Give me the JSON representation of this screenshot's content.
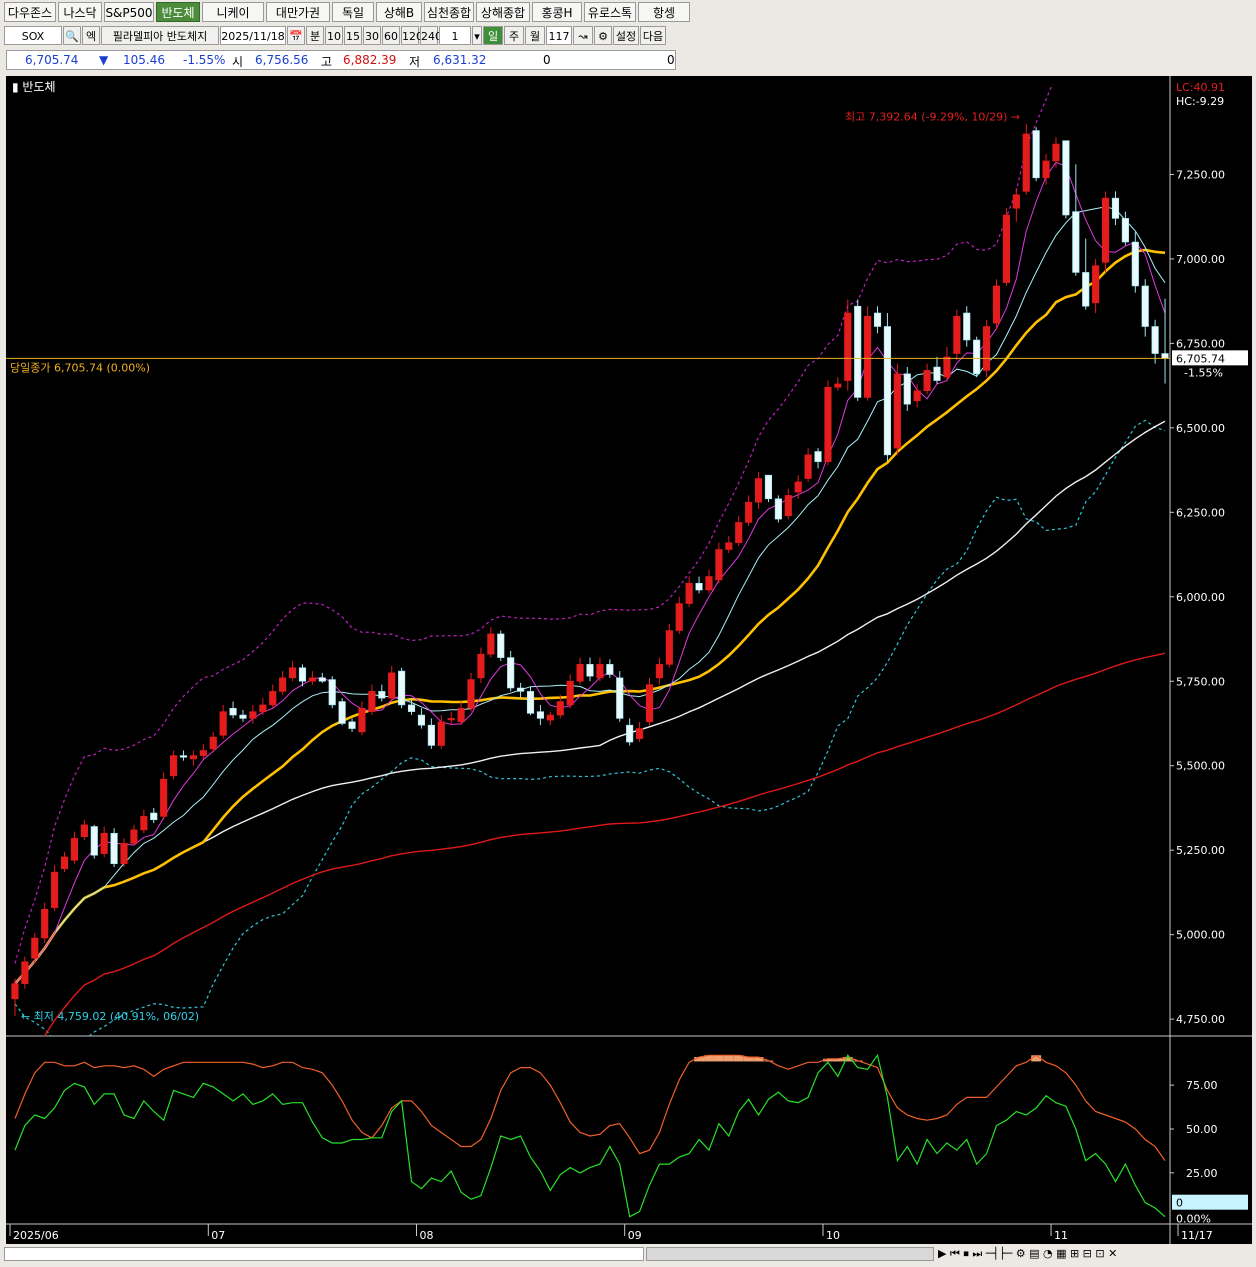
{
  "tabs": [
    "다우존스",
    "나스닥",
    "S&P500",
    "반도체",
    "니케이",
    "대만가권",
    "독일",
    "상해B",
    "심천종합",
    "상해종합",
    "홍콩H",
    "유로스톡",
    "항셍"
  ],
  "active_tab": "반도체",
  "toolbar": {
    "symbol": "SOX",
    "name_label": "필라델피아 반도체지",
    "date": "2025/11/18",
    "period_minute": "분",
    "minute_options": [
      "10",
      "15",
      "30",
      "60",
      "120",
      "240"
    ],
    "count": "1",
    "period_day": "일",
    "period_week": "주",
    "period_month": "월",
    "bars": "117",
    "settings_label": "설정",
    "next_label": "다음"
  },
  "quote": {
    "price": "6,705.74",
    "arrow": "▼",
    "change": "105.46",
    "change_pct": "-1.55%",
    "open_label": "시",
    "open": "6,756.56",
    "high_label": "고",
    "high": "6,882.39",
    "low_label": "저",
    "low": "6,631.32",
    "vol1": "0",
    "vol2": "0"
  },
  "chart_data": {
    "type": "candlestick",
    "title": "반도체",
    "x_labels": [
      {
        "i": 0,
        "label": "2025/06"
      },
      {
        "i": 20,
        "label": "07"
      },
      {
        "i": 41,
        "label": "08"
      },
      {
        "i": 62,
        "label": "09"
      },
      {
        "i": 82,
        "label": "10"
      },
      {
        "i": 105,
        "label": "11"
      },
      {
        "i": 116,
        "label": "11/17"
      }
    ],
    "y_ticks": [
      4750,
      5000,
      5250,
      5500,
      5750,
      6000,
      6250,
      6500,
      6750,
      7000,
      7250
    ],
    "ylim": [
      4700,
      7500
    ],
    "close_line": {
      "value": 6705.74,
      "label": "당일종가 6,705.74 (0.00%)"
    },
    "last_price_box": "6,705.74",
    "last_change_box": "-1.55%",
    "lc_label": "LC:40.91",
    "hc_label": "HC:-9.29",
    "high_annotation": {
      "value": 7392.64,
      "index": 103,
      "label": "최고 7,392.64 (-9.29%, 10/29)"
    },
    "low_annotation": {
      "value": 4759.02,
      "index": 0,
      "label": "최저 4,759.02 (40.91%, 06/02)"
    },
    "open": [
      4810,
      4855,
      4930,
      4990,
      5080,
      5195,
      5220,
      5290,
      5320,
      5240,
      5300,
      5210,
      5270,
      5310,
      5360,
      5350,
      5470,
      5530,
      5520,
      5530,
      5550,
      5590,
      5670,
      5650,
      5640,
      5660,
      5680,
      5720,
      5760,
      5790,
      5750,
      5760,
      5755,
      5690,
      5630,
      5600,
      5660,
      5720,
      5700,
      5780,
      5680,
      5650,
      5620,
      5560,
      5640,
      5630,
      5670,
      5760,
      5830,
      5890,
      5820,
      5730,
      5720,
      5660,
      5635,
      5650,
      5680,
      5750,
      5800,
      5760,
      5800,
      5760,
      5620,
      5580,
      5630,
      5760,
      5800,
      5900,
      5980,
      6040,
      6020,
      6050,
      6140,
      6160,
      6220,
      6280,
      6360,
      6290,
      6240,
      6310,
      6350,
      6430,
      6400,
      6620,
      6640,
      6860,
      6590,
      6840,
      6800,
      6440,
      6660,
      6580,
      6610,
      6680,
      6650,
      6720,
      6840,
      6760,
      6670,
      6810,
      6930,
      7150,
      7200,
      7380,
      7240,
      7290,
      7350,
      7140,
      6960,
      6870,
      6990,
      7180,
      7120,
      7050,
      6920,
      6800,
      6720
    ],
    "close": [
      4855,
      4920,
      4990,
      5075,
      5185,
      5230,
      5285,
      5325,
      5235,
      5300,
      5210,
      5270,
      5310,
      5350,
      5340,
      5460,
      5530,
      5525,
      5530,
      5545,
      5585,
      5660,
      5650,
      5640,
      5660,
      5680,
      5720,
      5760,
      5790,
      5750,
      5760,
      5750,
      5680,
      5625,
      5610,
      5670,
      5720,
      5700,
      5775,
      5680,
      5660,
      5620,
      5560,
      5630,
      5640,
      5670,
      5755,
      5830,
      5890,
      5820,
      5730,
      5720,
      5655,
      5640,
      5650,
      5690,
      5750,
      5800,
      5765,
      5800,
      5770,
      5640,
      5570,
      5610,
      5740,
      5800,
      5900,
      5980,
      6040,
      6020,
      6060,
      6140,
      6160,
      6220,
      6280,
      6350,
      6290,
      6230,
      6300,
      6340,
      6420,
      6400,
      6620,
      6630,
      6840,
      6590,
      6830,
      6800,
      6420,
      6660,
      6570,
      6610,
      6670,
      6640,
      6710,
      6830,
      6760,
      6660,
      6800,
      6920,
      7130,
      7190,
      7370,
      7240,
      7290,
      7340,
      7130,
      6960,
      6860,
      6980,
      7180,
      7120,
      7050,
      6920,
      6800,
      6720,
      6705.74
    ],
    "high": [
      4870,
      4935,
      5005,
      5095,
      5205,
      5245,
      5305,
      5340,
      5325,
      5320,
      5315,
      5285,
      5325,
      5370,
      5375,
      5480,
      5545,
      5545,
      5545,
      5565,
      5600,
      5680,
      5690,
      5665,
      5680,
      5700,
      5740,
      5780,
      5810,
      5800,
      5780,
      5775,
      5765,
      5700,
      5640,
      5690,
      5740,
      5740,
      5795,
      5790,
      5700,
      5670,
      5640,
      5650,
      5660,
      5690,
      5775,
      5850,
      5910,
      5900,
      5840,
      5745,
      5735,
      5680,
      5660,
      5710,
      5770,
      5820,
      5820,
      5820,
      5815,
      5780,
      5640,
      5630,
      5760,
      5820,
      5920,
      6000,
      6060,
      6060,
      6080,
      6160,
      6180,
      6240,
      6300,
      6370,
      6360,
      6300,
      6320,
      6360,
      6440,
      6440,
      6640,
      6650,
      6880,
      6880,
      6860,
      6860,
      6840,
      6690,
      6680,
      6630,
      6690,
      6710,
      6740,
      6850,
      6860,
      6770,
      6820,
      6940,
      7150,
      7210,
      7400,
      7390,
      7310,
      7360,
      7350,
      7280,
      7060,
      7000,
      7200,
      7200,
      7140,
      7080,
      6940,
      6820,
      6882.39
    ],
    "low": [
      4759,
      4840,
      4915,
      4975,
      5070,
      5185,
      5210,
      5280,
      5225,
      5230,
      5200,
      5200,
      5265,
      5300,
      5330,
      5340,
      5460,
      5515,
      5500,
      5520,
      5540,
      5580,
      5640,
      5630,
      5625,
      5650,
      5670,
      5710,
      5750,
      5735,
      5740,
      5745,
      5670,
      5620,
      5600,
      5590,
      5650,
      5690,
      5690,
      5670,
      5650,
      5610,
      5550,
      5550,
      5620,
      5620,
      5660,
      5745,
      5820,
      5810,
      5720,
      5700,
      5650,
      5620,
      5620,
      5640,
      5670,
      5740,
      5750,
      5750,
      5760,
      5630,
      5560,
      5570,
      5620,
      5740,
      5790,
      5890,
      5970,
      6010,
      6010,
      6040,
      6130,
      6150,
      6210,
      6260,
      6280,
      6220,
      6230,
      6290,
      6340,
      6380,
      6390,
      6610,
      6610,
      6580,
      6580,
      6780,
      6400,
      6420,
      6550,
      6560,
      6600,
      6630,
      6640,
      6700,
      6740,
      6650,
      6650,
      6790,
      6920,
      7110,
      7190,
      7230,
      7220,
      7270,
      7120,
      6950,
      6850,
      6840,
      6960,
      7100,
      7040,
      6900,
      6770,
      6690,
      6631.32
    ],
    "indicator": {
      "type": "stochastic",
      "y_ticks": [
        25,
        50,
        75
      ],
      "ylim": [
        -3,
        103
      ],
      "last_value_box": "0",
      "last_pct_box": "0.00%",
      "slow": [
        56,
        70,
        82,
        88,
        88,
        86,
        86,
        88,
        85,
        86,
        86,
        85,
        86,
        84,
        80,
        84,
        86,
        88,
        88,
        88,
        88,
        88,
        88,
        88,
        87,
        85,
        86,
        88,
        88,
        85,
        84,
        82,
        75,
        66,
        55,
        48,
        45,
        52,
        62,
        66,
        66,
        60,
        52,
        48,
        44,
        40,
        40,
        44,
        56,
        72,
        82,
        85,
        85,
        82,
        75,
        65,
        54,
        48,
        46,
        47,
        52,
        53,
        45,
        36,
        38,
        48,
        64,
        78,
        88,
        91,
        92,
        92,
        92,
        92,
        91,
        91,
        89,
        86,
        84,
        86,
        88,
        88,
        90,
        90,
        91,
        89,
        87,
        85,
        72,
        62,
        58,
        56,
        55,
        56,
        58,
        64,
        68,
        68,
        68,
        74,
        80,
        86,
        88,
        92,
        88,
        86,
        82,
        75,
        66,
        60,
        58,
        56,
        54,
        50,
        44,
        40,
        32
      ],
      "fast": [
        38,
        52,
        58,
        56,
        62,
        72,
        76,
        74,
        64,
        70,
        70,
        58,
        56,
        66,
        60,
        55,
        72,
        70,
        68,
        76,
        74,
        70,
        66,
        70,
        64,
        66,
        70,
        64,
        65,
        65,
        54,
        45,
        42,
        42,
        44,
        44,
        45,
        45,
        60,
        66,
        20,
        16,
        22,
        20,
        26,
        14,
        10,
        12,
        28,
        46,
        44,
        46,
        34,
        26,
        15,
        24,
        28,
        25,
        28,
        30,
        40,
        30,
        0,
        3,
        18,
        30,
        30,
        34,
        36,
        44,
        38,
        53,
        46,
        60,
        67,
        58,
        67,
        71,
        66,
        65,
        68,
        82,
        88,
        80,
        92,
        85,
        84,
        92,
        68,
        32,
        40,
        30,
        44,
        36,
        42,
        38,
        44,
        30,
        36,
        52,
        55,
        60,
        58,
        62,
        69,
        65,
        63,
        50,
        32,
        36,
        30,
        20,
        30,
        18,
        8,
        5,
        0
      ]
    }
  }
}
